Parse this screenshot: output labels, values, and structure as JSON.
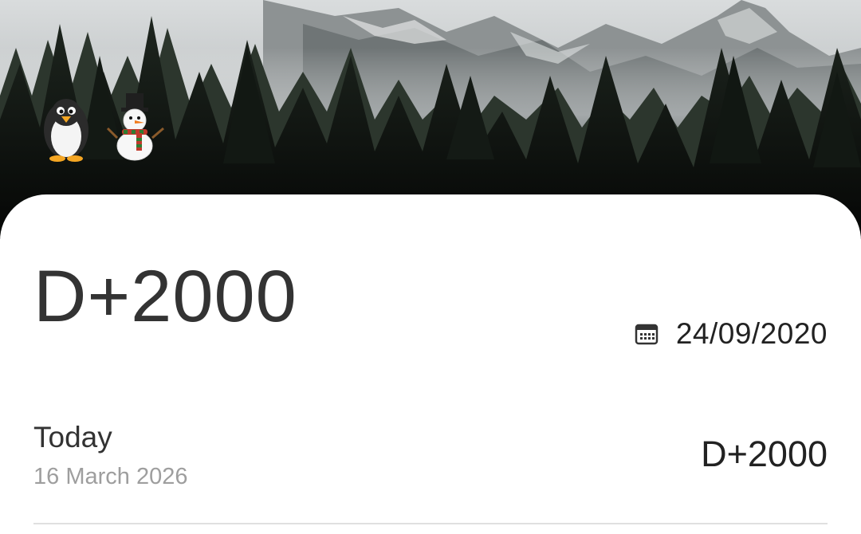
{
  "header": {
    "background": "misty-mountain-forest",
    "emojis": [
      {
        "name": "penguin-icon",
        "glyph": "🐧"
      },
      {
        "name": "snowman-icon",
        "glyph": "⛄"
      }
    ]
  },
  "counter": {
    "title": "D+2000",
    "start_date": "24/09/2020",
    "start_date_icon": "calendar-icon"
  },
  "today": {
    "label": "Today",
    "date": "16 March 2026",
    "count": "D+2000"
  },
  "colors": {
    "card": "#ffffff",
    "primary_text": "#333333",
    "secondary_text": "#9e9e9e",
    "divider": "#e0e0e0"
  }
}
